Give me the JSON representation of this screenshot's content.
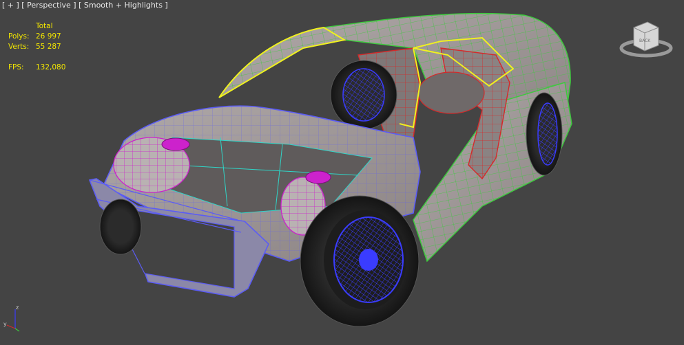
{
  "viewport": {
    "label_plus": "[ + ]",
    "label_view": "[ Perspective ]",
    "label_shading": "[ Smooth + Highlights ]"
  },
  "stats": {
    "header": "Total",
    "polys_label": "Polys:",
    "polys_value": "26 997",
    "verts_label": "Verts:",
    "verts_value": "55 287",
    "fps_label": "FPS:",
    "fps_value": "132,080"
  },
  "viewcube": {
    "face_label": "BACK"
  },
  "axis": {
    "y_label": "y",
    "z_label": "z"
  },
  "colors": {
    "background": "#444444",
    "stats_text": "#f2e600",
    "wire_blue": "#5b5cf5",
    "wire_green": "#3ec93e",
    "wire_red": "#d42a2a",
    "wire_magenta": "#cc22cc",
    "wire_cyan": "#2fd6c8",
    "wire_yellow": "#f0f020",
    "body_fill": "#9b9494"
  }
}
